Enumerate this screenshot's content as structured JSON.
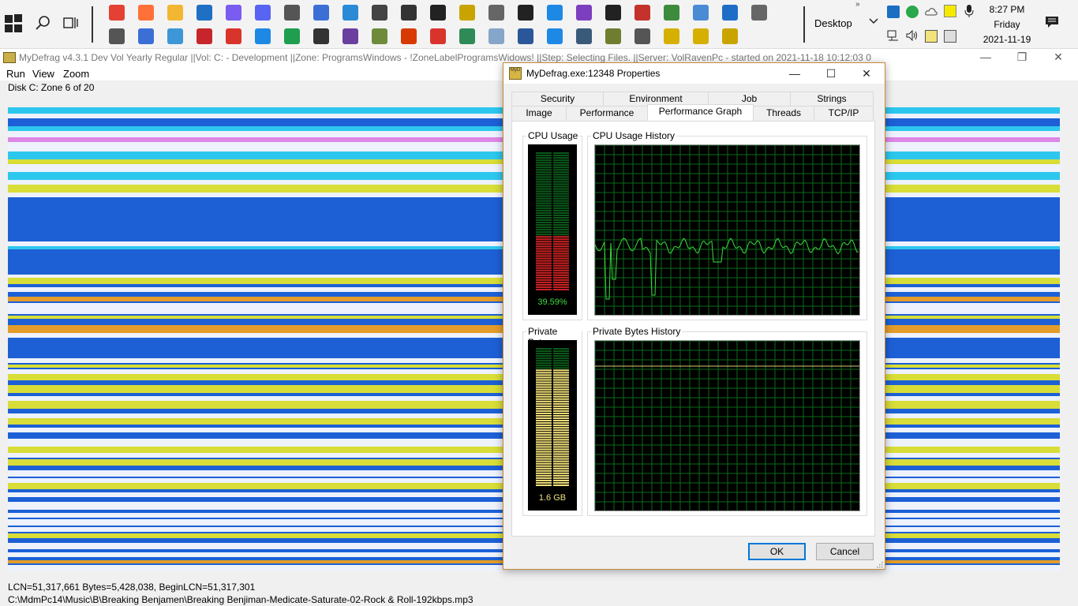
{
  "taskbar": {
    "desktop_label": "Desktop",
    "more_chevron": "»",
    "clock": {
      "time": "8:27 PM",
      "day": "Friday",
      "date": "2021-11-19"
    }
  },
  "app": {
    "title": "MyDefrag v4.3.1   Dev Vol Yearly Regular ||Vol: C: - Development ||Zone: ProgramsWindows - !ZoneLabelProgramsWidows! ||Step: Selecting Files. ||Server: VolRavenPc -  started on 2021-11-18 10:12:03 0:00:01",
    "menu": [
      "Run",
      "View",
      "Zoom"
    ],
    "zone_label": "Disk C:    Zone 6 of 20",
    "status_line1": "LCN=51,317,661     Bytes=5,428,038, BeginLCN=51,317,301",
    "status_line2": "C:\\MdmPc14\\Music\\B\\Breaking Benjamen\\Breaking Benjiman-Medicate-Saturate-02-Rock & Roll-192kbps.mp3",
    "colors": {
      "map_blue": "#1d60d6",
      "map_yellow": "#e8e82a",
      "map_orange": "#f5a21b",
      "map_white": "#ffffff",
      "map_cyan": "#2fd0f0"
    }
  },
  "dialog": {
    "title": "MyDefrag.exe:12348 Properties",
    "icon_text": "MyD",
    "tabs_row1": [
      "Security",
      "Environment",
      "Job",
      "Strings"
    ],
    "tabs_row2": [
      "Image",
      "Performance",
      "Performance Graph",
      "Threads",
      "TCP/IP"
    ],
    "selected_tab": "Performance Graph",
    "cpu_usage_label": "CPU Usage",
    "cpu_usage_value": "39.59%",
    "cpu_usage_fraction": 0.3959,
    "cpu_history_label": "CPU Usage History",
    "private_bytes_label": "Private Bytes",
    "private_bytes_value": "1.6 GB",
    "private_bytes_fraction": 0.85,
    "private_bytes_history_label": "Private Bytes History",
    "ok_label": "OK",
    "cancel_label": "Cancel",
    "graph_colors": {
      "grid": "#0a6b1a",
      "cpu_line": "#3ddc3d",
      "cpu_kernel": "#e03030",
      "cpu_meter_on": "#cc2222",
      "bytes_meter_on": "#f0e07a",
      "bytes_line": "#d9cd79"
    }
  }
}
